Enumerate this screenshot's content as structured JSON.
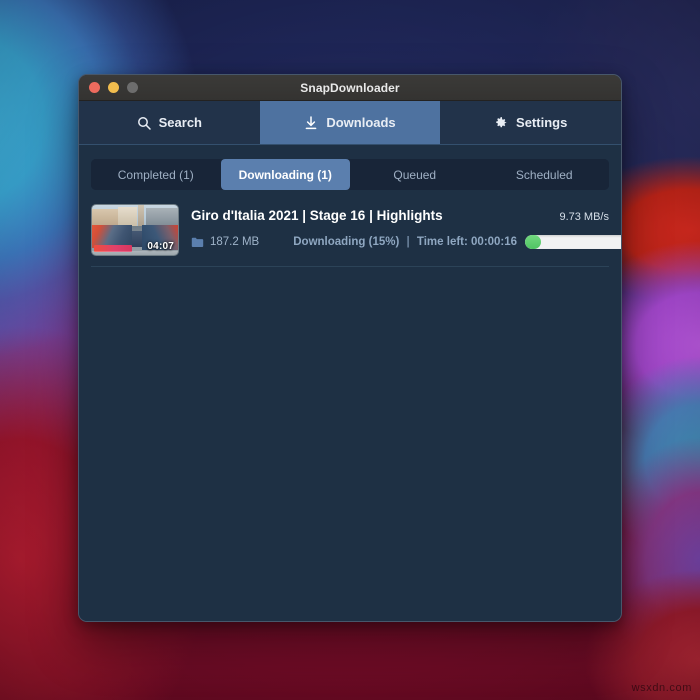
{
  "desktop": {
    "watermark": "wsxdn.com"
  },
  "window": {
    "title": "SnapDownloader",
    "traffic_lights": {
      "close": "close-button",
      "minimize": "minimize-button",
      "zoom": "zoom-button"
    }
  },
  "main_nav": {
    "tabs": [
      {
        "label": "Search",
        "icon": "search-icon",
        "active": false
      },
      {
        "label": "Downloads",
        "icon": "download-icon",
        "active": true
      },
      {
        "label": "Settings",
        "icon": "gear-icon",
        "active": false
      }
    ]
  },
  "subtabs": {
    "items": [
      {
        "label": "Completed (1)",
        "active": false
      },
      {
        "label": "Downloading (1)",
        "active": true
      },
      {
        "label": "Queued",
        "active": false
      },
      {
        "label": "Scheduled",
        "active": false
      }
    ]
  },
  "downloads": [
    {
      "title": "Giro d'Italia 2021 | Stage 16 | Highlights",
      "speed": "9.73 MB/s",
      "size": "187.2 MB",
      "status": "Downloading (15%)",
      "separator": "|",
      "time_left": "Time left: 00:00:16",
      "progress_percent": 15,
      "thumbnail_duration": "04:07",
      "pause_label": "pause-button",
      "cancel_label": "cancel-button"
    }
  ],
  "colors": {
    "window_bg": "#1e3044",
    "titlebar_bg": "#373634",
    "nav_bg": "#22334a",
    "nav_active": "#4e72a0",
    "subtab_bg": "#182538",
    "subtab_active": "#5b7fae",
    "progress_fill": "#5cc96c",
    "progress_track": "#f1f2f3",
    "cancel_red": "#e8513f",
    "tl_close": "#ed6b5e",
    "tl_min": "#f2bd4e",
    "tl_zoom": "#6d6d6d"
  }
}
